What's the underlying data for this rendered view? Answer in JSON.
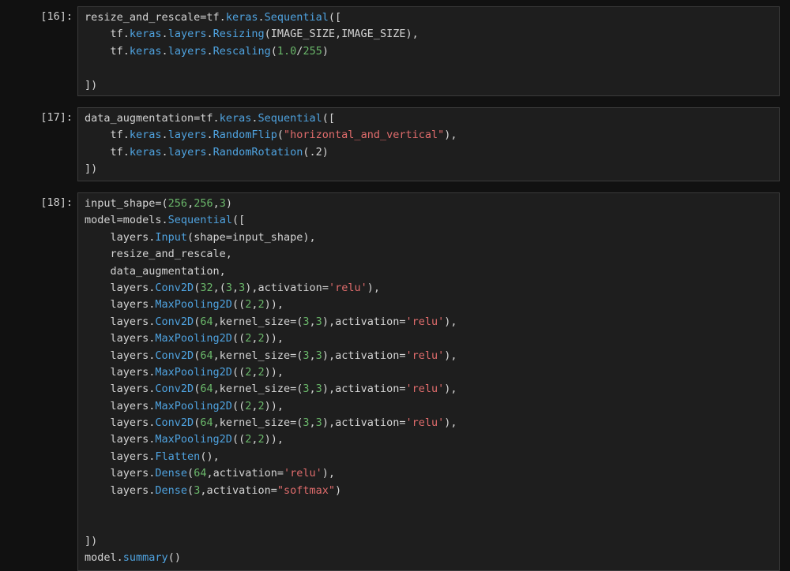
{
  "colors": {
    "background": "#111111",
    "cell_background": "#1e1e1e",
    "cell_border": "#3b3b3b",
    "prompt_text": "#cfcfcf",
    "plain_text": "#d4d4d4",
    "attribute": "#4fa3e0",
    "number": "#6ab76a",
    "string": "#e06c6c"
  },
  "cells": [
    {
      "prompt": "[16]:",
      "lines": [
        [
          [
            "plain",
            "resize_and_rescale=tf."
          ],
          [
            "attr",
            "keras"
          ],
          [
            "plain",
            "."
          ],
          [
            "attr",
            "Sequential"
          ],
          [
            "plain",
            "(["
          ]
        ],
        [
          [
            "plain",
            "    tf."
          ],
          [
            "attr",
            "keras"
          ],
          [
            "plain",
            "."
          ],
          [
            "attr",
            "layers"
          ],
          [
            "plain",
            "."
          ],
          [
            "attr",
            "Resizing"
          ],
          [
            "plain",
            "(IMAGE_SIZE,IMAGE_SIZE),"
          ]
        ],
        [
          [
            "plain",
            "    tf."
          ],
          [
            "attr",
            "keras"
          ],
          [
            "plain",
            "."
          ],
          [
            "attr",
            "layers"
          ],
          [
            "plain",
            "."
          ],
          [
            "attr",
            "Rescaling"
          ],
          [
            "plain",
            "("
          ],
          [
            "num",
            "1.0"
          ],
          [
            "plain",
            "/"
          ],
          [
            "num",
            "255"
          ],
          [
            "plain",
            ")"
          ]
        ],
        [
          [
            "plain",
            ""
          ]
        ],
        [
          [
            "plain",
            "])"
          ]
        ]
      ]
    },
    {
      "prompt": "[17]:",
      "lines": [
        [
          [
            "plain",
            "data_augmentation=tf."
          ],
          [
            "attr",
            "keras"
          ],
          [
            "plain",
            "."
          ],
          [
            "attr",
            "Sequential"
          ],
          [
            "plain",
            "(["
          ]
        ],
        [
          [
            "plain",
            "    tf."
          ],
          [
            "attr",
            "keras"
          ],
          [
            "plain",
            "."
          ],
          [
            "attr",
            "layers"
          ],
          [
            "plain",
            "."
          ],
          [
            "attr",
            "RandomFlip"
          ],
          [
            "plain",
            "("
          ],
          [
            "str",
            "\"horizontal_and_vertical\""
          ],
          [
            "plain",
            "),"
          ]
        ],
        [
          [
            "plain",
            "    tf."
          ],
          [
            "attr",
            "keras"
          ],
          [
            "plain",
            "."
          ],
          [
            "attr",
            "layers"
          ],
          [
            "plain",
            "."
          ],
          [
            "attr",
            "RandomRotation"
          ],
          [
            "plain",
            "(.2)"
          ]
        ],
        [
          [
            "plain",
            "])"
          ]
        ]
      ]
    },
    {
      "prompt": "[18]:",
      "lines": [
        [
          [
            "plain",
            "input_shape=("
          ],
          [
            "num",
            "256"
          ],
          [
            "plain",
            ","
          ],
          [
            "num",
            "256"
          ],
          [
            "plain",
            ","
          ],
          [
            "num",
            "3"
          ],
          [
            "plain",
            ")"
          ]
        ],
        [
          [
            "plain",
            "model=models."
          ],
          [
            "attr",
            "Sequential"
          ],
          [
            "plain",
            "(["
          ]
        ],
        [
          [
            "plain",
            "    layers."
          ],
          [
            "attr",
            "Input"
          ],
          [
            "plain",
            "(shape=input_shape),"
          ]
        ],
        [
          [
            "plain",
            "    resize_and_rescale,"
          ]
        ],
        [
          [
            "plain",
            "    data_augmentation,"
          ]
        ],
        [
          [
            "plain",
            "    layers."
          ],
          [
            "attr",
            "Conv2D"
          ],
          [
            "plain",
            "("
          ],
          [
            "num",
            "32"
          ],
          [
            "plain",
            ",("
          ],
          [
            "num",
            "3"
          ],
          [
            "plain",
            ","
          ],
          [
            "num",
            "3"
          ],
          [
            "plain",
            "),activation="
          ],
          [
            "str",
            "'relu'"
          ],
          [
            "plain",
            "),"
          ]
        ],
        [
          [
            "plain",
            "    layers."
          ],
          [
            "attr",
            "MaxPooling2D"
          ],
          [
            "plain",
            "(("
          ],
          [
            "num",
            "2"
          ],
          [
            "plain",
            ","
          ],
          [
            "num",
            "2"
          ],
          [
            "plain",
            ")),"
          ]
        ],
        [
          [
            "plain",
            "    layers."
          ],
          [
            "attr",
            "Conv2D"
          ],
          [
            "plain",
            "("
          ],
          [
            "num",
            "64"
          ],
          [
            "plain",
            ",kernel_size=("
          ],
          [
            "num",
            "3"
          ],
          [
            "plain",
            ","
          ],
          [
            "num",
            "3"
          ],
          [
            "plain",
            "),activation="
          ],
          [
            "str",
            "'relu'"
          ],
          [
            "plain",
            "),"
          ]
        ],
        [
          [
            "plain",
            "    layers."
          ],
          [
            "attr",
            "MaxPooling2D"
          ],
          [
            "plain",
            "(("
          ],
          [
            "num",
            "2"
          ],
          [
            "plain",
            ","
          ],
          [
            "num",
            "2"
          ],
          [
            "plain",
            ")),"
          ]
        ],
        [
          [
            "plain",
            "    layers."
          ],
          [
            "attr",
            "Conv2D"
          ],
          [
            "plain",
            "("
          ],
          [
            "num",
            "64"
          ],
          [
            "plain",
            ",kernel_size=("
          ],
          [
            "num",
            "3"
          ],
          [
            "plain",
            ","
          ],
          [
            "num",
            "3"
          ],
          [
            "plain",
            "),activation="
          ],
          [
            "str",
            "'relu'"
          ],
          [
            "plain",
            "),"
          ]
        ],
        [
          [
            "plain",
            "    layers."
          ],
          [
            "attr",
            "MaxPooling2D"
          ],
          [
            "plain",
            "(("
          ],
          [
            "num",
            "2"
          ],
          [
            "plain",
            ","
          ],
          [
            "num",
            "2"
          ],
          [
            "plain",
            ")),"
          ]
        ],
        [
          [
            "plain",
            "    layers."
          ],
          [
            "attr",
            "Conv2D"
          ],
          [
            "plain",
            "("
          ],
          [
            "num",
            "64"
          ],
          [
            "plain",
            ",kernel_size=("
          ],
          [
            "num",
            "3"
          ],
          [
            "plain",
            ","
          ],
          [
            "num",
            "3"
          ],
          [
            "plain",
            "),activation="
          ],
          [
            "str",
            "'relu'"
          ],
          [
            "plain",
            "),"
          ]
        ],
        [
          [
            "plain",
            "    layers."
          ],
          [
            "attr",
            "MaxPooling2D"
          ],
          [
            "plain",
            "(("
          ],
          [
            "num",
            "2"
          ],
          [
            "plain",
            ","
          ],
          [
            "num",
            "2"
          ],
          [
            "plain",
            ")),"
          ]
        ],
        [
          [
            "plain",
            "    layers."
          ],
          [
            "attr",
            "Conv2D"
          ],
          [
            "plain",
            "("
          ],
          [
            "num",
            "64"
          ],
          [
            "plain",
            ",kernel_size=("
          ],
          [
            "num",
            "3"
          ],
          [
            "plain",
            ","
          ],
          [
            "num",
            "3"
          ],
          [
            "plain",
            "),activation="
          ],
          [
            "str",
            "'relu'"
          ],
          [
            "plain",
            "),"
          ]
        ],
        [
          [
            "plain",
            "    layers."
          ],
          [
            "attr",
            "MaxPooling2D"
          ],
          [
            "plain",
            "(("
          ],
          [
            "num",
            "2"
          ],
          [
            "plain",
            ","
          ],
          [
            "num",
            "2"
          ],
          [
            "plain",
            ")),"
          ]
        ],
        [
          [
            "plain",
            "    layers."
          ],
          [
            "attr",
            "Flatten"
          ],
          [
            "plain",
            "(),"
          ]
        ],
        [
          [
            "plain",
            "    layers."
          ],
          [
            "attr",
            "Dense"
          ],
          [
            "plain",
            "("
          ],
          [
            "num",
            "64"
          ],
          [
            "plain",
            ",activation="
          ],
          [
            "str",
            "'relu'"
          ],
          [
            "plain",
            "),"
          ]
        ],
        [
          [
            "plain",
            "    layers."
          ],
          [
            "attr",
            "Dense"
          ],
          [
            "plain",
            "("
          ],
          [
            "num",
            "3"
          ],
          [
            "plain",
            ",activation="
          ],
          [
            "str",
            "\"softmax\""
          ],
          [
            "plain",
            ")"
          ]
        ],
        [
          [
            "plain",
            ""
          ]
        ],
        [
          [
            "plain",
            ""
          ]
        ],
        [
          [
            "plain",
            "])"
          ]
        ],
        [
          [
            "plain",
            "model."
          ],
          [
            "attr",
            "summary"
          ],
          [
            "plain",
            "()"
          ]
        ]
      ]
    }
  ]
}
